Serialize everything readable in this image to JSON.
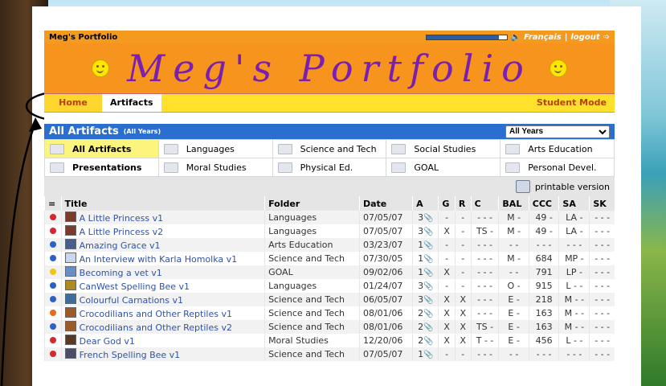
{
  "topbar": {
    "title": "Meg's Portfolio",
    "progress": 0.9,
    "lang_link": "Français",
    "separator": "|",
    "logout_link": "logout"
  },
  "banner": {
    "title": "Meg's Portfolio"
  },
  "nav": {
    "home": "Home",
    "artifacts": "Artifacts",
    "mode": "Student Mode"
  },
  "section": {
    "title": "All Artifacts",
    "subtitle": "(All Years)",
    "year_filter": "All Years"
  },
  "categories": [
    "All Artifacts",
    "Languages",
    "Science and Tech",
    "Social Studies",
    "Arts Education",
    "Presentations",
    "Moral Studies",
    "Physical Ed.",
    "GOAL",
    "Personal Devel."
  ],
  "print_label": "printable version",
  "table": {
    "headers": [
      "=",
      "Title",
      "Folder",
      "Date",
      "A",
      "G",
      "R",
      "C",
      "BAL",
      "CCC",
      "SA",
      "SK"
    ],
    "rows": [
      {
        "dot": "#d7262d",
        "title": "A Little Princess v1",
        "folder": "Languages",
        "date": "07/05/07",
        "a": "3",
        "g": "-",
        "r": "-",
        "c": "- - -",
        "bal": "M -",
        "ccc": "49 -",
        "sa": "LA -",
        "sk": "- - -"
      },
      {
        "dot": "#d7262d",
        "title": "A Little Princess v2",
        "folder": "Languages",
        "date": "07/05/07",
        "a": "3",
        "g": "X",
        "r": "-",
        "c": "TS -",
        "bal": "M -",
        "ccc": "49 -",
        "sa": "LA -",
        "sk": "- - -"
      },
      {
        "dot": "#2a62c9",
        "title": "Amazing Grace v1",
        "folder": "Arts Education",
        "date": "03/23/07",
        "a": "1",
        "g": "-",
        "r": "-",
        "c": "- - -",
        "bal": "- -",
        "ccc": "- - -",
        "sa": "- - -",
        "sk": "- - -"
      },
      {
        "dot": "#2a62c9",
        "title": "An Interview with Karla Homolka v1",
        "folder": "Science and Tech",
        "date": "07/30/05",
        "a": "1",
        "g": "-",
        "r": "-",
        "c": "- - -",
        "bal": "M -",
        "ccc": "684",
        "sa": "MP -",
        "sk": "- - -"
      },
      {
        "dot": "#f0c419",
        "title": "Becoming a vet v1",
        "folder": "GOAL",
        "date": "09/02/06",
        "a": "1",
        "g": "X",
        "r": "-",
        "c": "- - -",
        "bal": "- -",
        "ccc": "791",
        "sa": "LP -",
        "sk": "- - -"
      },
      {
        "dot": "#2a62c9",
        "title": "CanWest Spelling Bee v1",
        "folder": "Languages",
        "date": "01/24/07",
        "a": "3",
        "g": "-",
        "r": "-",
        "c": "- - -",
        "bal": "O -",
        "ccc": "915",
        "sa": "L - -",
        "sk": "- - -"
      },
      {
        "dot": "#2a62c9",
        "title": "Colourful Carnations v1",
        "folder": "Science and Tech",
        "date": "06/05/07",
        "a": "3",
        "g": "X",
        "r": "X",
        "c": "- - -",
        "bal": "E -",
        "ccc": "218",
        "sa": "M - -",
        "sk": "- - -"
      },
      {
        "dot": "#e86a1c",
        "title": "Crocodilians and Other Reptiles v1",
        "folder": "Science and Tech",
        "date": "08/01/06",
        "a": "2",
        "g": "X",
        "r": "X",
        "c": "- - -",
        "bal": "E -",
        "ccc": "163",
        "sa": "M - -",
        "sk": "- - -"
      },
      {
        "dot": "#2a62c9",
        "title": "Crocodilians and Other Reptiles v2",
        "folder": "Science and Tech",
        "date": "08/01/06",
        "a": "2",
        "g": "X",
        "r": "X",
        "c": "TS -",
        "bal": "E -",
        "ccc": "163",
        "sa": "M - -",
        "sk": "- - -"
      },
      {
        "dot": "#d7262d",
        "title": "Dear God v1",
        "folder": "Moral Studies",
        "date": "12/20/06",
        "a": "2",
        "g": "X",
        "r": "X",
        "c": "T - -",
        "bal": "E -",
        "ccc": "456",
        "sa": "L - -",
        "sk": "- - -"
      },
      {
        "dot": "#d7262d",
        "title": "French Spelling Bee v1",
        "folder": "Science and Tech",
        "date": "07/05/07",
        "a": "1",
        "g": "-",
        "r": "-",
        "c": "- - -",
        "bal": "- -",
        "ccc": "- - -",
        "sa": "- - -",
        "sk": "- - -"
      }
    ]
  }
}
